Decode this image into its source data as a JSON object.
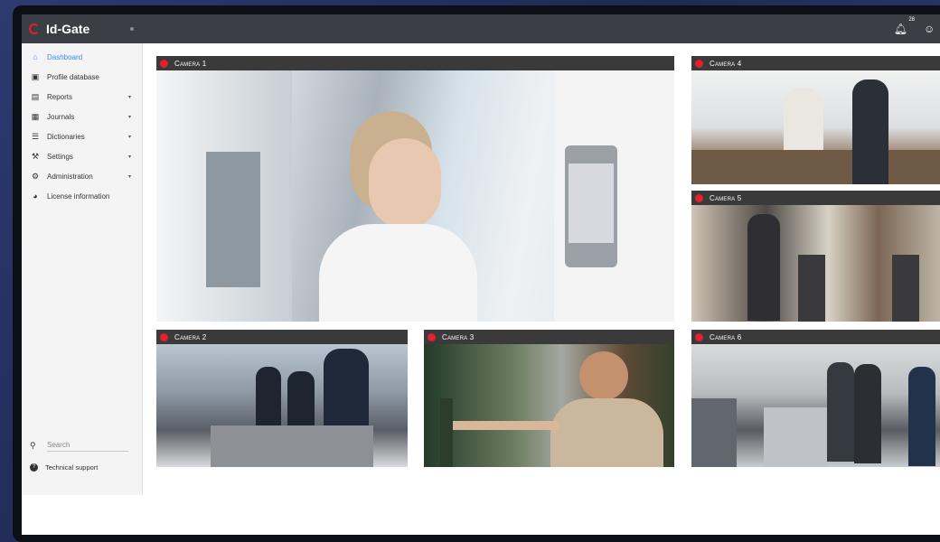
{
  "app": {
    "name": "Id-Gate"
  },
  "topbar": {
    "notification_count": "28"
  },
  "sidebar": {
    "items": [
      {
        "label": "Dashboard",
        "icon": "home-icon",
        "active": true,
        "expandable": false
      },
      {
        "label": "Profile database",
        "icon": "id-card-icon",
        "active": false,
        "expandable": false
      },
      {
        "label": "Reports",
        "icon": "report-icon",
        "active": false,
        "expandable": true
      },
      {
        "label": "Journals",
        "icon": "table-icon",
        "active": false,
        "expandable": true
      },
      {
        "label": "Dictionaries",
        "icon": "list-icon",
        "active": false,
        "expandable": true
      },
      {
        "label": "Settings",
        "icon": "wrench-icon",
        "active": false,
        "expandable": true
      },
      {
        "label": "Administration",
        "icon": "gear-icon",
        "active": false,
        "expandable": true
      },
      {
        "label": "License information",
        "icon": "license-icon",
        "active": false,
        "expandable": false
      }
    ],
    "search": {
      "placeholder": "Search"
    },
    "support": {
      "label": "Technical support"
    }
  },
  "cameras": [
    {
      "title": "Camera 1"
    },
    {
      "title": "Camera 2"
    },
    {
      "title": "Camera 3"
    },
    {
      "title": "Camera 4"
    },
    {
      "title": "Camera 5"
    },
    {
      "title": "Camera 6"
    }
  ],
  "colors": {
    "accent": "#3c8ee8",
    "live_dot": "#e3202c",
    "topbar": "#3b3e44"
  }
}
